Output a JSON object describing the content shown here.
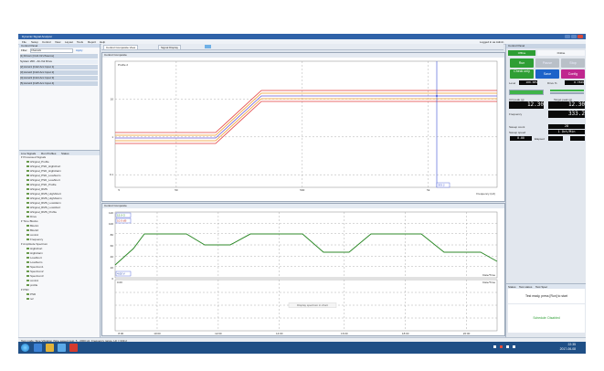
{
  "window": {
    "title": "Dynamic Signal Analyzer"
  },
  "menu": [
    "File",
    "Setup",
    "Control",
    "View",
    "Layout",
    "Tools",
    "Report",
    "Help"
  ],
  "user": "Logged in as Admin",
  "tabs": [
    "Control Composite View",
    "Signal Display"
  ],
  "left": {
    "header": "Control Panel",
    "filter_label": "Filter",
    "filter_value": "Channels",
    "filter_btn": "Apply",
    "channels": [
      "[1] Drive1   [CH1 Drv/Source]",
      "System 200 - Air-Vol Drive",
      "[2] Accel1   [CH2 Acc Input 1]",
      "[3] Accel2   [CH3 Acc Input 2]",
      "[4] Accel3   [CH4 Acc Input 3]",
      "[5] Accel4   [CH5 Acc Input 4]"
    ],
    "tabs": [
      "Live Signals",
      "Run Profiles",
      "Status"
    ],
    "tree_folder1": "Processed Signals",
    "tree_items1": [
      "HSignal_Profile",
      "HSignal_PSD_HighAbort",
      "HSignal_PSD_HighAlarm",
      "HSignal_PSD_LowAlarm",
      "HSignal_PSD_LowAbort",
      "HSignal_PSD_Profile",
      "HSignal_RMS",
      "HSignal_RMS_HighAbort",
      "HSignal_RMS_HighAlarm",
      "HSignal_RMS_LowAlarm",
      "HSignal_RMS_LowAbort",
      "HSignal_RMS_Profile",
      "Drive"
    ],
    "tree_folder2": "Time Blocks",
    "tree_items2": [
      "Block1",
      "Block2",
      "control",
      "Frequency"
    ],
    "tree_folder3": "Amplitude Spectrum",
    "tree_items3": [
      "HighAbort",
      "HighAlarm",
      "LowAbort",
      "LowAlarm",
      "Spectrum1",
      "Spectrum2",
      "Spectrum3",
      "control",
      "profile"
    ],
    "tree_folder4": "PSD",
    "tree_items4": [
      "PSD",
      "ref"
    ]
  },
  "chart1": {
    "caption": "Control Composite",
    "series_label": "Profile 2",
    "x_ticks": [
      "5",
      "50",
      "500",
      "5k"
    ],
    "y_ticks": [
      "10",
      "1",
      "0.1"
    ],
    "marker_label": "333.2",
    "legend": "Frequency (Hz)"
  },
  "chart2": {
    "caption": "Control Composite",
    "readout1": "15.0 G",
    "readout2": "10.0 dB",
    "x_ticks": [
      "8:00",
      "10:00",
      "12:00",
      "14:00",
      "16:00",
      "18:00",
      "20:00"
    ],
    "y_ticks": [
      "120",
      "100",
      "80",
      "60",
      "40",
      "20",
      "0"
    ],
    "axis_label": "Date/Time",
    "lower_readout": "4.00 V",
    "lower_readout2": "0.00",
    "watermark": "Display spectrum in chart"
  },
  "right": {
    "header": "Control Panel",
    "tab_online": "Online",
    "tab_offline": "Offline",
    "run": "Run",
    "pause": "Pause",
    "stop": "Stop",
    "check_only": "Check only",
    "save": "Save",
    "config": "Config",
    "level_label": "Level",
    "level_value": "100.00%",
    "drive_label": "Drive %",
    "drive_value": "0.7849",
    "ctrl_peak_label": "Ctrl peak (g)",
    "ctrl_peak": "12.30",
    "target_peak_label": "Target peak (g)",
    "target_peak": "12.30",
    "frequency_label": "Frequency",
    "frequency": "333.2",
    "sweep_count_label": "Sweep count",
    "sweep_count": "28",
    "sweep_speed_label": "Sweep speed",
    "sweep_speed": "1 Oct/Min",
    "elapsed_label": "Elapsed",
    "elapsed": "0.00",
    "status_tabs": [
      "Status",
      "Test status",
      "Test Spec"
    ],
    "status_msg": "Test ready, press [Run] to start",
    "schedule": "Schedule: Disabled"
  },
  "statusbar": "Test mode: Sine Vibration (Sine sweep) test, 5 - 2000 Hz, Frequency range, Hz = 333.2",
  "taskbar": {
    "time": "22:35",
    "date": "2017-06-08"
  },
  "colors": {
    "accent_green": "#2e9e34",
    "accent_blue": "#1d63c9",
    "config_magenta": "#c0278f",
    "title_blue": "#2f62a8"
  }
}
